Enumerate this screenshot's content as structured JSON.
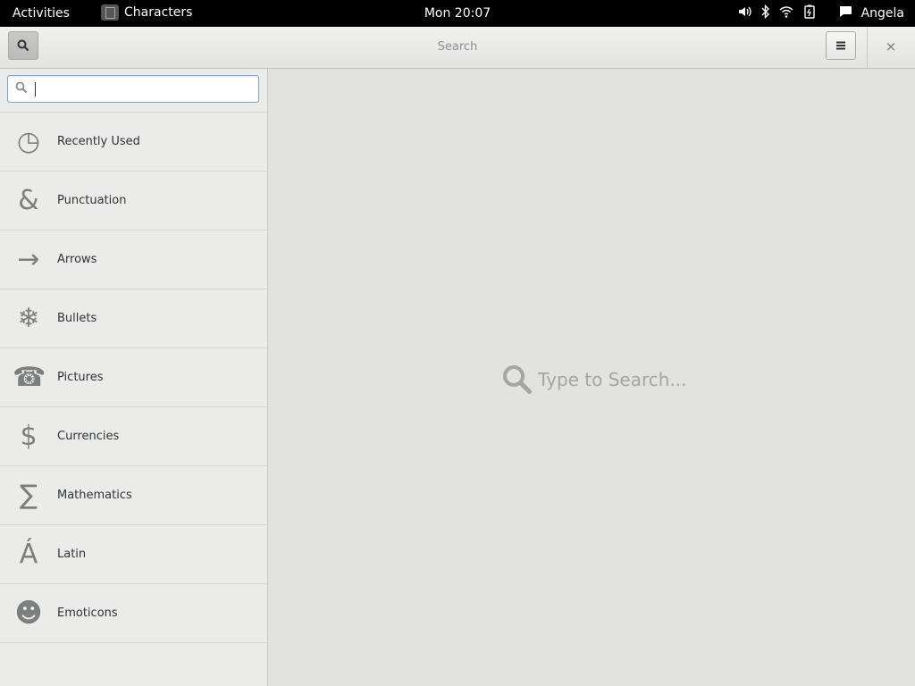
{
  "topbar": {
    "activities": "Activities",
    "app_name": "Characters",
    "clock": "Mon 20:07",
    "user": "Angela",
    "tray_icons": [
      "volume-icon",
      "bluetooth-icon",
      "wifi-icon",
      "battery-icon",
      "chat-icon"
    ]
  },
  "header": {
    "title": "Search",
    "close_glyph": "×"
  },
  "search": {
    "value": "",
    "placeholder": ""
  },
  "categories": [
    {
      "label": "Recently Used",
      "glyph": "◷",
      "icon": "clock-icon"
    },
    {
      "label": "Punctuation",
      "glyph": "&",
      "icon": "ampersand-icon"
    },
    {
      "label": "Arrows",
      "glyph": "→",
      "icon": "arrow-icon"
    },
    {
      "label": "Bullets",
      "glyph": "❄",
      "icon": "bullet-icon"
    },
    {
      "label": "Pictures",
      "glyph": "☎",
      "icon": "telephone-icon"
    },
    {
      "label": "Currencies",
      "glyph": "$",
      "icon": "dollar-icon"
    },
    {
      "label": "Mathematics",
      "glyph": "∑",
      "icon": "sigma-icon"
    },
    {
      "label": "Latin",
      "glyph": "Á",
      "icon": "latin-a-icon"
    },
    {
      "label": "Emoticons",
      "glyph": "☻",
      "icon": "smiley-icon"
    }
  ],
  "main": {
    "placeholder": "Type to Search..."
  }
}
